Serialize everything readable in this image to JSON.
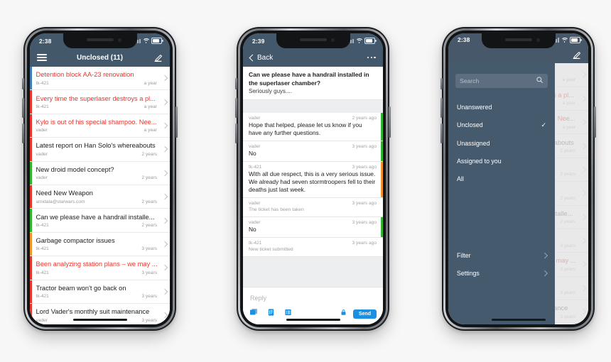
{
  "colors": {
    "header_bg": "#44586b",
    "menu_bg": "#465a6d",
    "accent_blue": "#1d8fe0",
    "urgent_red": "#e8362c",
    "page_bg": "#f7f7f7",
    "status_red": "#e8362c",
    "status_green": "#2eb72e",
    "status_orange": "#f2922c",
    "status_blue": "#3f7fb8"
  },
  "phone1": {
    "status_bar": {
      "time": "2:38"
    },
    "header": {
      "title": "Unclosed (11)",
      "menu_icon": "hamburger-icon",
      "compose_icon": "compose-icon"
    },
    "tickets": [
      {
        "subject": "Detention block AA-23 renovation",
        "author": "tk-421",
        "age": "a year",
        "urgent": true,
        "accent": "#3f7fb8"
      },
      {
        "subject": "Every time the superlaser destroys a pl...",
        "author": "tk-421",
        "age": "a year",
        "urgent": true,
        "accent": "#e8362c"
      },
      {
        "subject": "Kylo is out of his special shampoo. Nee...",
        "author": "vader",
        "age": "a year",
        "urgent": true,
        "accent": "#e8362c"
      },
      {
        "subject": "Latest report on Han Solo's whereabouts",
        "author": "vader",
        "age": "2 years",
        "urgent": false,
        "accent": "#e8362c"
      },
      {
        "subject": "New droid model concept?",
        "author": "vader",
        "age": "2 years",
        "urgent": false,
        "accent": "#2eb72e"
      },
      {
        "subject": "Need New Weapon",
        "author": "amidala@starwars.com",
        "age": "2 years",
        "urgent": false,
        "accent": "#e8362c"
      },
      {
        "subject": "Can we please have a handrail installe...",
        "author": "tk-421",
        "age": "2 years",
        "urgent": false,
        "accent": "#2eb72e"
      },
      {
        "subject": "Garbage compactor issues",
        "author": "tk-421",
        "age": "3 years",
        "urgent": false,
        "accent": "#f2922c"
      },
      {
        "subject": "Been analyzing station plans – we may ...",
        "author": "tk-421",
        "age": "3 years",
        "urgent": true,
        "accent": "#e8362c"
      },
      {
        "subject": "Tractor beam won't go back on",
        "author": "tk-421",
        "age": "3 years",
        "urgent": false,
        "accent": "#e8362c"
      },
      {
        "subject": "Lord Vader's monthly suit maintenance",
        "author": "vader",
        "age": "3 years",
        "urgent": false,
        "accent": "#e8362c"
      }
    ]
  },
  "phone2": {
    "status_bar": {
      "time": "2:39"
    },
    "header": {
      "back_label": "Back",
      "back_icon": "chevron-left-icon",
      "more_icon": "more-options-icon"
    },
    "messages": [
      {
        "kind": "first",
        "text": "Can we please have a handrail installed in the superlaser chamber?",
        "sub": "Seriously guys....",
        "side": ""
      },
      {
        "kind": "normal",
        "author": "vader",
        "time": "2 years ago",
        "text": "Hope that helped, please let us know if you have any further questions.",
        "side": "#2eb72e"
      },
      {
        "kind": "normal",
        "author": "vader",
        "time": "3 years ago",
        "text": "No",
        "side": "#2eb72e"
      },
      {
        "kind": "normal",
        "author": "tk-421",
        "time": "3 years ago",
        "text": "With all due respect, this is a very serious issue. We already had seven stormtroopers fell to their deaths just last week.",
        "side": "#f2922c"
      },
      {
        "kind": "system",
        "author": "vader",
        "time": "3 years ago",
        "text": "The ticket has been taken",
        "side": ""
      },
      {
        "kind": "normal",
        "author": "vader",
        "time": "3 years ago",
        "text": "No",
        "side": "#2eb72e"
      },
      {
        "kind": "system",
        "author": "tk-421",
        "time": "3 years ago",
        "text": "New ticket submitted",
        "side": ""
      }
    ],
    "composer": {
      "reply_placeholder": "Reply",
      "send_label": "Send",
      "icons": [
        "attach-image-icon",
        "canned-response-icon",
        "knowledge-base-icon",
        "lock-icon"
      ]
    }
  },
  "phone3": {
    "status_bar": {
      "time": "2:38"
    },
    "header": {
      "compose_icon": "compose-icon"
    },
    "menu": {
      "search_placeholder": "Search",
      "search_icon": "search-icon",
      "items": [
        {
          "label": "Unanswered",
          "checked": false,
          "chevron": false
        },
        {
          "label": "Unclosed",
          "checked": true,
          "chevron": false
        },
        {
          "label": "Unassigned",
          "checked": false,
          "chevron": false
        },
        {
          "label": "Assigned to you",
          "checked": false,
          "chevron": false
        },
        {
          "label": "All",
          "checked": false,
          "chevron": false
        }
      ],
      "bottom_items": [
        {
          "label": "Filter",
          "checked": false,
          "chevron": true
        },
        {
          "label": "Settings",
          "checked": false,
          "chevron": true
        }
      ],
      "check_glyph": "✓"
    }
  }
}
